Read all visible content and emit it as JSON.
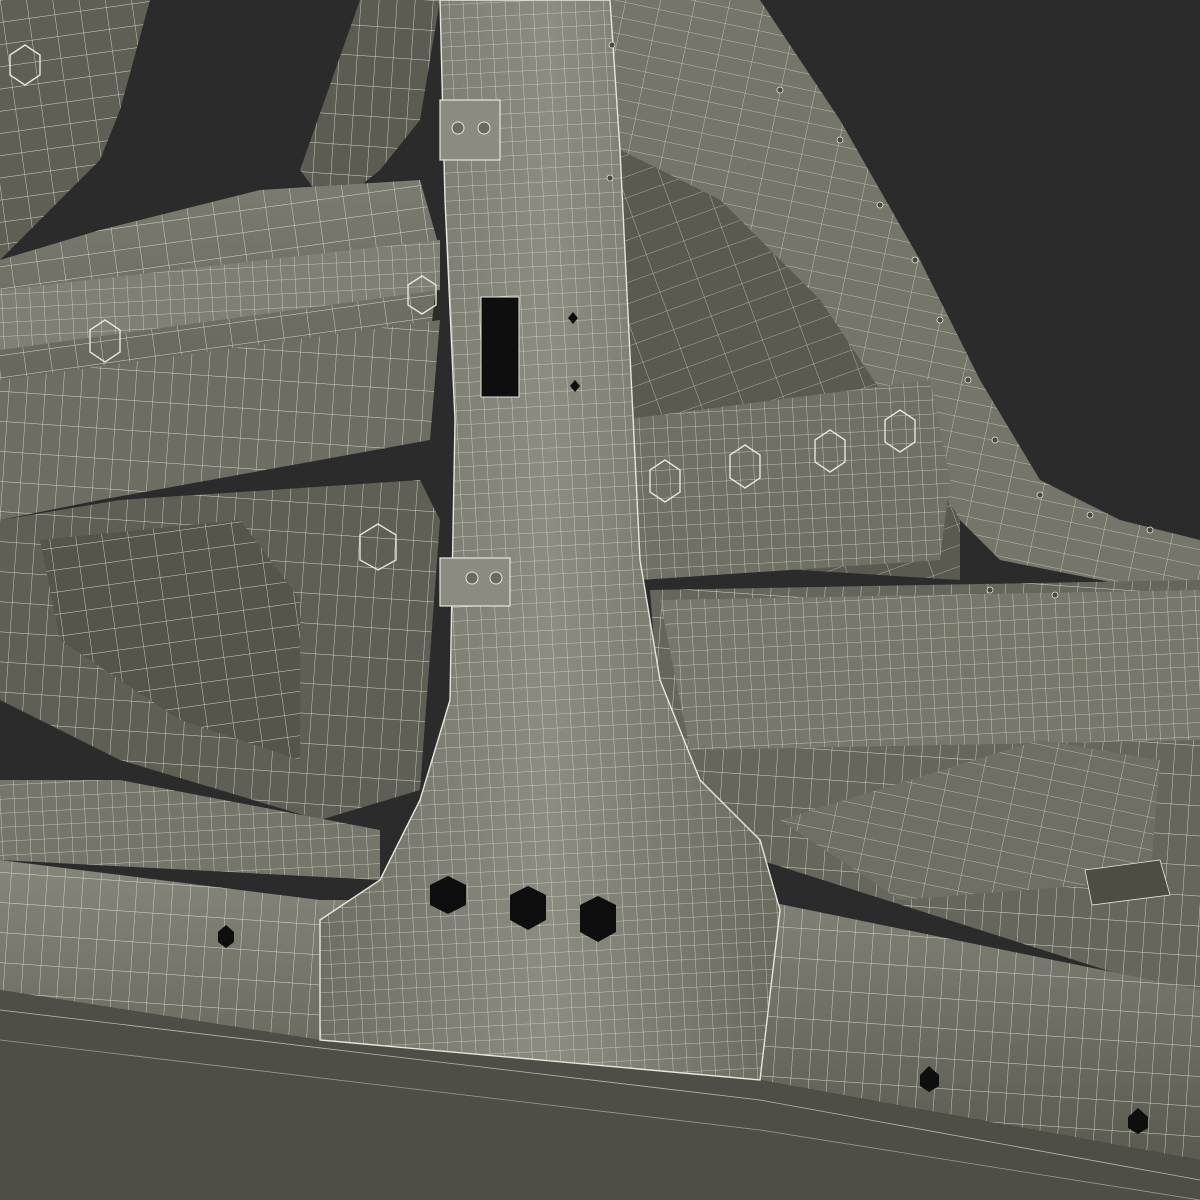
{
  "scene": {
    "background_color": "#2b2b2b",
    "surface_color": "#6b6b5f",
    "surface_light_color": "#8a8a7d",
    "surface_dark_color": "#4a4a42",
    "wire_color": "#e6e6da",
    "hole_color": "#0e0e0e"
  }
}
